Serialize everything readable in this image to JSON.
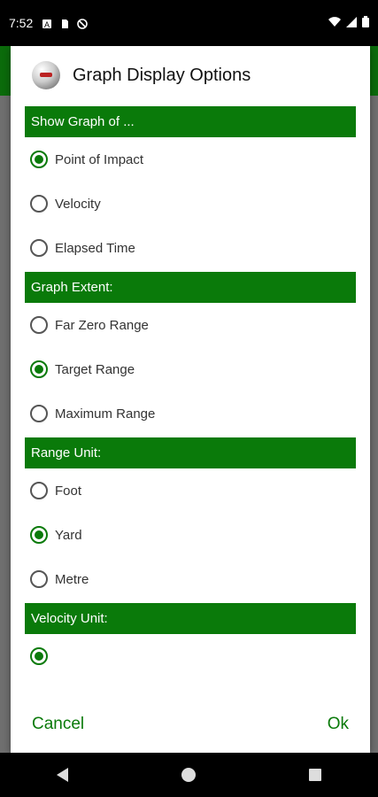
{
  "status_bar": {
    "time": "7:52",
    "icons": [
      "notification-a-icon",
      "sd-card-icon",
      "block-icon"
    ],
    "right_icons": [
      "wifi-icon",
      "signal-icon",
      "battery-icon"
    ]
  },
  "dialog": {
    "title": "Graph Display Options",
    "sections": [
      {
        "header": "Show Graph of ...",
        "options": [
          {
            "label": "Point of Impact",
            "checked": true
          },
          {
            "label": "Velocity",
            "checked": false
          },
          {
            "label": "Elapsed Time",
            "checked": false
          }
        ]
      },
      {
        "header": "Graph Extent:",
        "options": [
          {
            "label": "Far Zero Range",
            "checked": false
          },
          {
            "label": "Target Range",
            "checked": true
          },
          {
            "label": "Maximum Range",
            "checked": false
          }
        ]
      },
      {
        "header": "Range Unit:",
        "options": [
          {
            "label": "Foot",
            "checked": false
          },
          {
            "label": "Yard",
            "checked": true
          },
          {
            "label": "Metre",
            "checked": false
          }
        ]
      },
      {
        "header": "Velocity Unit:",
        "options": [
          {
            "label": "",
            "checked": true
          }
        ]
      }
    ],
    "cancel_label": "Cancel",
    "ok_label": "Ok"
  },
  "colors": {
    "accent": "#0a7a0a",
    "section_bg": "#0a7a0a"
  }
}
